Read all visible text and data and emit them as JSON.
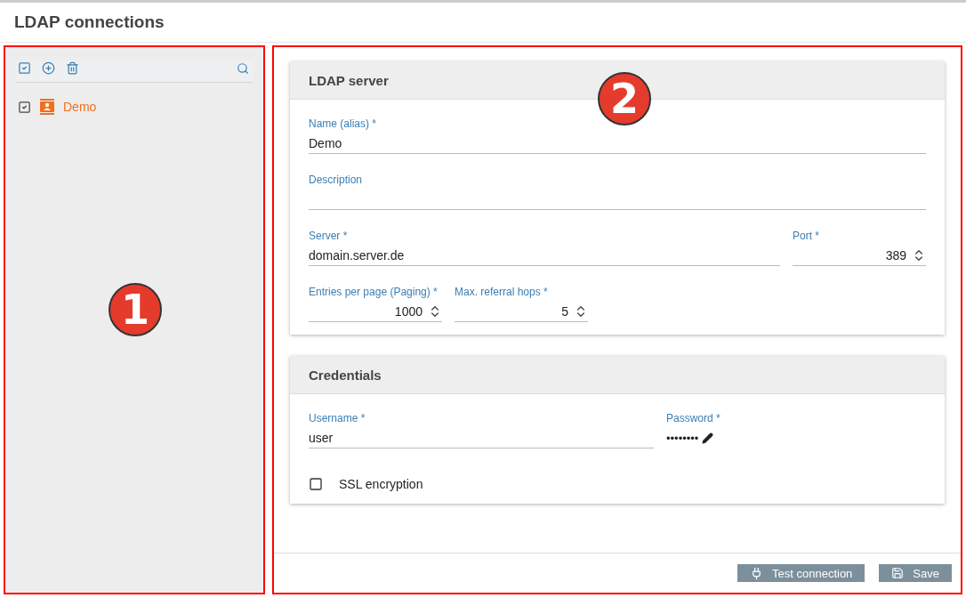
{
  "page": {
    "title": "LDAP connections"
  },
  "sidebar": {
    "items": [
      {
        "label": "Demo",
        "checked": true,
        "selected": true
      }
    ]
  },
  "sections": [
    {
      "title": "LDAP server",
      "rows": [
        [
          {
            "kind": "text",
            "label": "Name (alias) *",
            "value": "Demo"
          }
        ],
        [
          {
            "kind": "text",
            "label": "Description"
          }
        ],
        [
          {
            "kind": "text",
            "label": "Server *",
            "value": "domain.server.de"
          },
          {
            "kind": "number",
            "label": "Port *",
            "value": "389"
          }
        ],
        [
          {
            "kind": "number",
            "label": "Entries per page (Paging) *",
            "value": "1000"
          },
          {
            "kind": "number",
            "label": "Max. referral hops *",
            "value": "5"
          }
        ]
      ]
    },
    {
      "title": "Credentials",
      "rows": [
        [
          {
            "kind": "text",
            "label": "Username *",
            "value": "user"
          },
          {
            "kind": "password",
            "label": "Password *",
            "value": "••••••••"
          }
        ],
        [
          {
            "kind": "checkbox",
            "label": "SSL encryption",
            "checked": false
          }
        ]
      ]
    }
  ],
  "actions": [
    {
      "kind": "test",
      "label": "Test connection"
    },
    {
      "kind": "save",
      "label": "Save"
    }
  ],
  "callouts": [
    {
      "label": "1"
    },
    {
      "label": "2"
    }
  ]
}
